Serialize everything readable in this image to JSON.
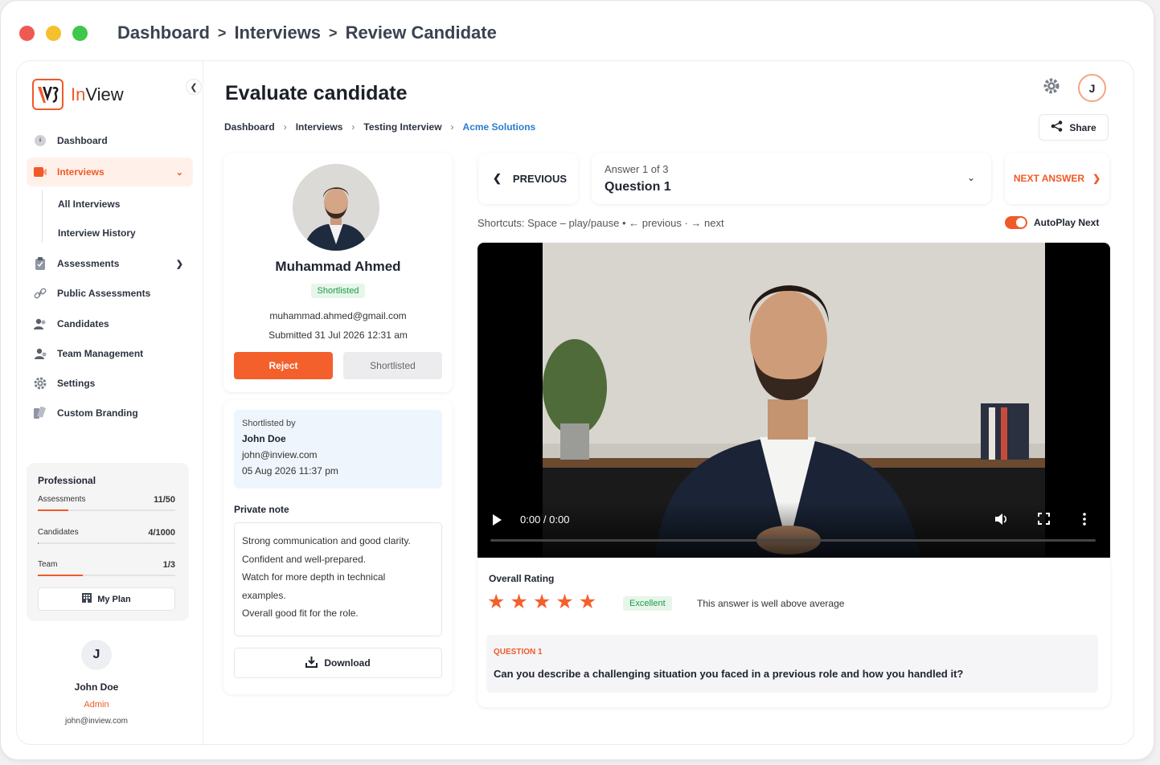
{
  "window": {
    "breadcrumb": [
      "Dashboard",
      "Interviews",
      "Review Candidate"
    ]
  },
  "brand": {
    "name_prefix": "In",
    "name_suffix": "View",
    "accent": "#f05a28"
  },
  "sidebar": {
    "items": [
      {
        "label": "Dashboard",
        "icon": "dashboard-icon"
      },
      {
        "label": "Interviews",
        "icon": "video-icon"
      },
      {
        "label": "Assessments",
        "icon": "clipboard-icon"
      },
      {
        "label": "Public Assessments",
        "icon": "link-icon"
      },
      {
        "label": "Candidates",
        "icon": "users-icon"
      },
      {
        "label": "Team Management",
        "icon": "team-icon"
      },
      {
        "label": "Settings",
        "icon": "gear-icon"
      },
      {
        "label": "Custom Branding",
        "icon": "palette-icon"
      }
    ],
    "sub_items": [
      "All Interviews",
      "Interview History"
    ],
    "plan": {
      "title": "Professional",
      "rows": [
        {
          "label": "Assessments",
          "value": "11/50",
          "fraction": 0.22
        },
        {
          "label": "Candidates",
          "value": "4/1000",
          "fraction": 0.004
        },
        {
          "label": "Team",
          "value": "1/3",
          "fraction": 0.33
        }
      ],
      "button": "My Plan"
    },
    "user": {
      "initial": "J",
      "name": "John Doe",
      "role": "Admin",
      "email": "john@inview.com"
    }
  },
  "header": {
    "title": "Evaluate candidate",
    "avatar_initial": "J",
    "breadcrumb": [
      "Dashboard",
      "Interviews",
      "Testing Interview",
      "Acme Solutions"
    ],
    "share_label": "Share"
  },
  "candidate": {
    "name": "Muhammad Ahmed",
    "status": "Shortlisted",
    "email": "muhammad.ahmed@gmail.com",
    "submitted": "Submitted 31 Jul 2026 12:31 am",
    "reject_label": "Reject",
    "shortlisted_label": "Shortlisted"
  },
  "shortlist": {
    "label": "Shortlisted by",
    "name": "John Doe",
    "email": "john@inview.com",
    "date": "05 Aug 2026 11:37 pm"
  },
  "note": {
    "title": "Private note",
    "lines": [
      "Strong communication and good clarity.",
      "Confident and well-prepared.",
      "Watch for more depth in technical",
      "examples.",
      "Overall good fit for the role."
    ],
    "download_label": "Download"
  },
  "answer_nav": {
    "previous_label": "PREVIOUS",
    "counter": "Answer 1 of 3",
    "question": "Question 1",
    "next_label": "NEXT ANSWER",
    "shortcuts": "Shortcuts: Space – play/pause • ← previous · → next",
    "autoplay_label": "AutoPlay Next",
    "autoplay_on": true
  },
  "video": {
    "time": "0:00 / 0:00",
    "progress": 0
  },
  "rating": {
    "title": "Overall Rating",
    "stars": 5,
    "badge": "Excellent",
    "text": "This answer is well above average",
    "question_label": "QUESTION 1",
    "question_text": "Can you describe a challenging situation you faced in a previous role and how you handled it?"
  }
}
